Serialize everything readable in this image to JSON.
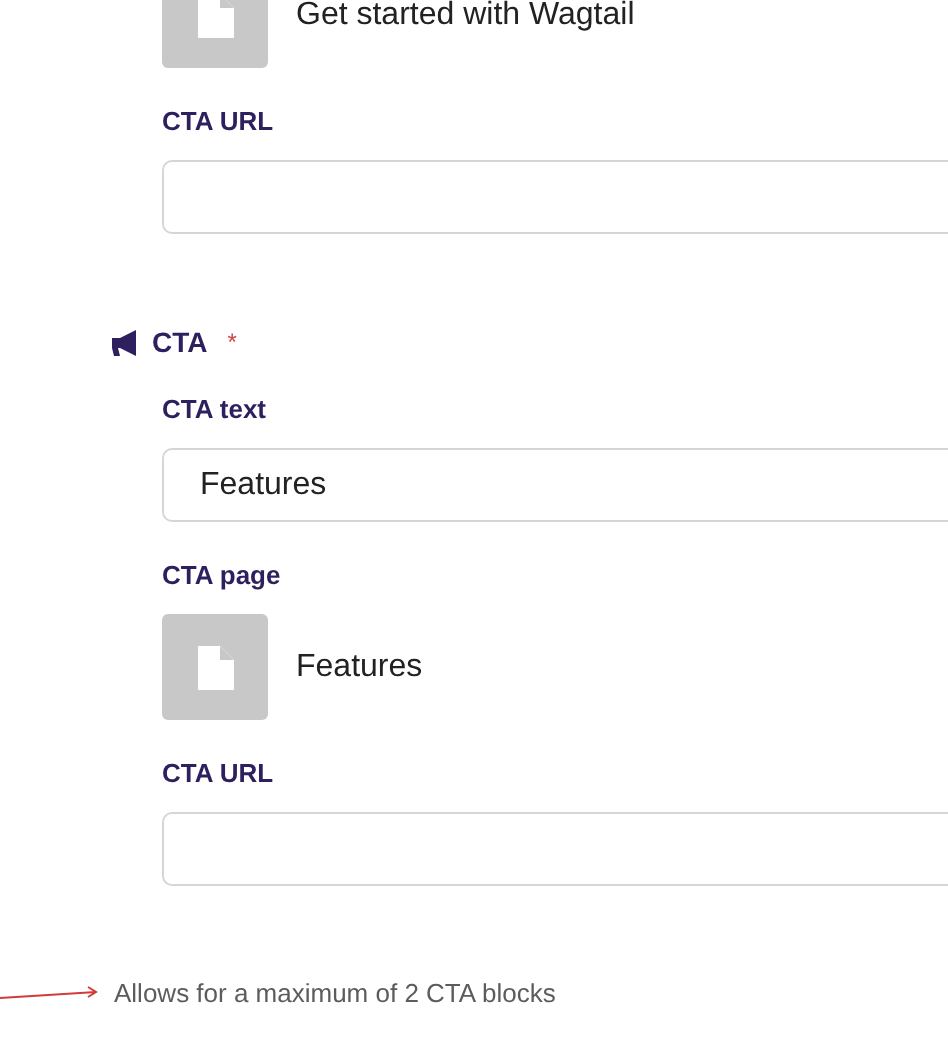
{
  "blocks": [
    {
      "fields": [
        {
          "kind": "page",
          "value": "Get started with Wagtail"
        },
        {
          "kind": "text",
          "label": "CTA URL"
        }
      ]
    },
    {
      "heading": "CTA",
      "required_mark": "*",
      "fields": [
        {
          "kind": "text",
          "label": "CTA text",
          "value": "Features"
        },
        {
          "kind": "page",
          "label": "CTA page",
          "value": "Features"
        },
        {
          "kind": "text",
          "label": "CTA URL"
        }
      ]
    }
  ],
  "help_text": "Allows for a maximum of 2 CTA blocks"
}
